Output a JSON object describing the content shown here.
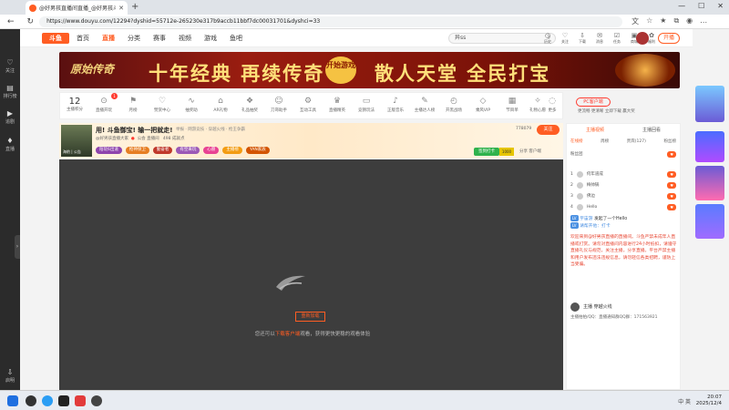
{
  "browser": {
    "tab_title": "@好男孩直播间直播_@好男孩斗",
    "url": "https://www.douyu.com/12294?dyshid=55712e-265230e317b9accb11bbf7dc00031701&dyshci=33",
    "new_tab": "+"
  },
  "header": {
    "logo_text": "斗鱼",
    "nav": [
      "首页",
      "直播",
      "分类",
      "赛事",
      "视频",
      "游戏",
      "鱼吧"
    ],
    "active_nav": "直播",
    "search_value": "异ss",
    "icons": [
      {
        "name": "history-icon",
        "label": "历史"
      },
      {
        "name": "follow-icon",
        "label": "关注"
      },
      {
        "name": "download-icon",
        "label": "下载"
      },
      {
        "name": "message-icon",
        "label": "消息"
      },
      {
        "name": "task-icon",
        "label": "任务"
      },
      {
        "name": "shop-icon",
        "label": "商城"
      },
      {
        "name": "gift-icon",
        "label": "福利"
      }
    ],
    "open_button": "开播"
  },
  "left_sidebar": [
    {
      "icon": "heart-icon",
      "label": "关注"
    },
    {
      "icon": "rank-icon",
      "label": "排行榜"
    },
    {
      "icon": "play-icon",
      "label": "追剧"
    },
    {
      "icon": "bookmark-icon",
      "label": "直播"
    },
    {
      "icon": "download-icon",
      "label": "启明"
    }
  ],
  "banner": {
    "left": "原始传奇",
    "main1": "十年经典 再续传奇",
    "badge": "开始游戏",
    "main2": "散人天堂 全民打宝"
  },
  "categories": {
    "rank_number": "12",
    "rank_label": "主播积分",
    "badge_count": "1",
    "items": [
      "直播开玩",
      "月榜",
      "赞赏中心",
      "抽奖助",
      "AR礼物",
      "礼品抽奖",
      "刀哥助手",
      "互动工具",
      "直播精英",
      "竞猜玩法",
      "正版音乐",
      "主播达人榜",
      "开黑战场",
      "乘风VIP",
      "节目单",
      "礼物心愿",
      "更多"
    ],
    "pc_client": "PC客户端",
    "pc_sub": "更流畅 更清晰 立即下载 赢大奖"
  },
  "room": {
    "anchor_name": "@好男孩",
    "anchor_sub": "海豹 | 公告",
    "title": "用! 斗鱼御宝! 输一把就走!",
    "meta": "举报 · 网游竞技 · 穿越火线 · 枪王争霸",
    "line2_prefix": "@好男孩直播大家",
    "line2_mid": "公会  直播间",
    "line2_suffix": "498 成就点",
    "tags": [
      "陪玩6出道",
      "枪神保卫",
      "勤奋者",
      "有空来玩",
      "心愿",
      "主播榜",
      "YAN家族"
    ],
    "fans": "778079",
    "follow": "关注",
    "signin": "签到打卡",
    "signbar": "1000",
    "actions": "分享   客户端"
  },
  "player": {
    "load_button": "重新加载",
    "tip_prefix": "您还可以",
    "tip_link": "下载客户端",
    "tip_suffix": "观看，获得更快更稳的观看体验"
  },
  "right_panel": {
    "top_tabs": [
      "主播视频",
      "主播回看"
    ],
    "sub_tabs": [
      "在线榜",
      "周榜",
      "贵宾(127)",
      "粉丝榜"
    ],
    "ranking": [
      {
        "no": "1",
        "name": "何年道成"
      },
      {
        "no": "2",
        "name": "梅帅锅"
      },
      {
        "no": "3",
        "name": "佛边"
      },
      {
        "no": "4",
        "name": "Hello"
      }
    ],
    "rank_hint": "粉丝团",
    "chat_user": "宇宙游",
    "chat_msg": "发起了一个Hello",
    "chat_tip": "请帮开他：打卡",
    "notice": "欢迎来到@好男孩直播的直播间。斗鱼严禁未成年人直播或打赏。请勿对直播间内容进行24小时抵扣，请遵守直播礼仪与规范，关注主播，分享直播。平台严禁主播和用户发布违法违规信息，请勿轻信各类招聘，谨防上当受骗。",
    "anchor_card_name": "主播    穿越火线",
    "anchor_card_qq": "主播拍拍/QQ：直播通知群QQ群：171563921"
  },
  "taskbar": {
    "time": "20:07",
    "date": "2025/12/4",
    "tray": "中 英"
  }
}
